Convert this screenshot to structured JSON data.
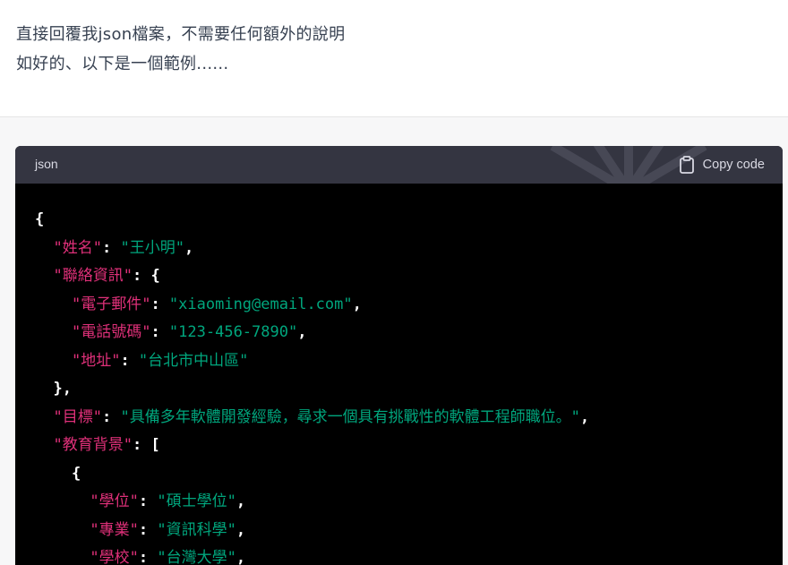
{
  "user_message": {
    "line1": "直接回覆我json檔案，不需要任何額外的說明",
    "line2": "如好的、以下是一個範例......"
  },
  "code_block": {
    "language": "json",
    "copy_label": "Copy code",
    "icon": "clipboard-icon",
    "lines": [
      {
        "indent": "",
        "parts": [
          {
            "t": "punc",
            "v": "{"
          }
        ]
      },
      {
        "indent": "  ",
        "parts": [
          {
            "t": "key",
            "v": "\"姓名\""
          },
          {
            "t": "punc",
            "v": ": "
          },
          {
            "t": "str",
            "v": "\"王小明\""
          },
          {
            "t": "punc",
            "v": ","
          }
        ]
      },
      {
        "indent": "  ",
        "parts": [
          {
            "t": "key",
            "v": "\"聯絡資訊\""
          },
          {
            "t": "punc",
            "v": ": {"
          }
        ]
      },
      {
        "indent": "    ",
        "parts": [
          {
            "t": "key",
            "v": "\"電子郵件\""
          },
          {
            "t": "punc",
            "v": ": "
          },
          {
            "t": "str",
            "v": "\"xiaoming@email.com\""
          },
          {
            "t": "punc",
            "v": ","
          }
        ]
      },
      {
        "indent": "    ",
        "parts": [
          {
            "t": "key",
            "v": "\"電話號碼\""
          },
          {
            "t": "punc",
            "v": ": "
          },
          {
            "t": "str",
            "v": "\"123-456-7890\""
          },
          {
            "t": "punc",
            "v": ","
          }
        ]
      },
      {
        "indent": "    ",
        "parts": [
          {
            "t": "key",
            "v": "\"地址\""
          },
          {
            "t": "punc",
            "v": ": "
          },
          {
            "t": "str",
            "v": "\"台北市中山區\""
          }
        ]
      },
      {
        "indent": "  ",
        "parts": [
          {
            "t": "punc",
            "v": "},"
          }
        ]
      },
      {
        "indent": "  ",
        "parts": [
          {
            "t": "key",
            "v": "\"目標\""
          },
          {
            "t": "punc",
            "v": ": "
          },
          {
            "t": "str",
            "v": "\"具備多年軟體開發經驗，尋求一個具有挑戰性的軟體工程師職位。\""
          },
          {
            "t": "punc",
            "v": ","
          }
        ]
      },
      {
        "indent": "  ",
        "parts": [
          {
            "t": "key",
            "v": "\"教育背景\""
          },
          {
            "t": "punc",
            "v": ": ["
          }
        ]
      },
      {
        "indent": "    ",
        "parts": [
          {
            "t": "punc",
            "v": "{"
          }
        ]
      },
      {
        "indent": "      ",
        "parts": [
          {
            "t": "key",
            "v": "\"學位\""
          },
          {
            "t": "punc",
            "v": ": "
          },
          {
            "t": "str",
            "v": "\"碩士學位\""
          },
          {
            "t": "punc",
            "v": ","
          }
        ]
      },
      {
        "indent": "      ",
        "parts": [
          {
            "t": "key",
            "v": "\"專業\""
          },
          {
            "t": "punc",
            "v": ": "
          },
          {
            "t": "str",
            "v": "\"資訊科學\""
          },
          {
            "t": "punc",
            "v": ","
          }
        ]
      },
      {
        "indent": "      ",
        "parts": [
          {
            "t": "key",
            "v": "\"學校\""
          },
          {
            "t": "punc",
            "v": ": "
          },
          {
            "t": "str",
            "v": "\"台灣大學\""
          },
          {
            "t": "punc",
            "v": ","
          }
        ]
      }
    ]
  },
  "colors": {
    "key": "#df3079",
    "string": "#00a67d",
    "code_bg": "#000000",
    "header_bg": "#343541"
  }
}
